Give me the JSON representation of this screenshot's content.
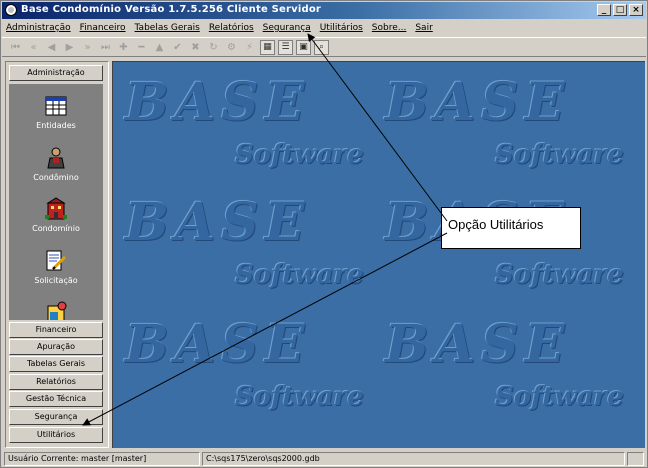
{
  "window": {
    "title": "Base Condomínio Versão 1.7.5.256 Cliente Servidor",
    "controls": {
      "minimize": "_",
      "maximize": "□",
      "close": "×"
    }
  },
  "menubar": {
    "items": [
      "Administração",
      "Financeiro",
      "Tabelas Gerais",
      "Relatórios",
      "Segurança",
      "Utilitários",
      "Sobre...",
      "Sair"
    ]
  },
  "toolbar": {
    "buttons": [
      "first-icon",
      "rewind-icon",
      "prev-icon",
      "next-icon",
      "fast-forward-icon",
      "last-icon",
      "insert-icon",
      "delete-icon",
      "edit-icon",
      "post-icon",
      "cancel-icon",
      "refresh-icon",
      "print-icon",
      "filter-icon",
      "report-icon",
      "grid-icon",
      "zoom-icon",
      "search-icon"
    ]
  },
  "sidebar": {
    "header": "Administração",
    "items": [
      {
        "label": "Entidades",
        "icon": "table-icon"
      },
      {
        "label": "Condômino",
        "icon": "person-icon"
      },
      {
        "label": "Condomínio",
        "icon": "building-icon"
      },
      {
        "label": "Solicitação",
        "icon": "document-pen-icon"
      }
    ],
    "sections": [
      "Financeiro",
      "Apuração",
      "Tabelas Gerais",
      "Relatórios",
      "Gestão Técnica",
      "Segurança",
      "Utilitários"
    ]
  },
  "main": {
    "watermark": {
      "logo": "BASE",
      "tagline": "Software"
    }
  },
  "callout": {
    "text": "Opção Utilitários"
  },
  "statusbar": {
    "user": "Usuário Corrente:  master [master]",
    "database": "C:\\sqs175\\zero\\sqs2000.gdb"
  }
}
